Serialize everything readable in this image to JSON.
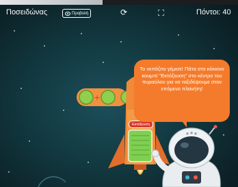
{
  "header": {
    "title": "Ποσειδώνας",
    "preview_label": "Προβολή",
    "points_label": "Πόντοι: 40"
  },
  "icons": {
    "preview": "eye-icon",
    "sync": "sync-icon",
    "fullscreen": "fullscreen-icon"
  },
  "dialog": {
    "text": "Το νεπόζιτο γέμισε! Πάτα στο κόκκινο κουμπί \"Εκτόξευση\" στο κέντρο του πυραύλου για να ταξιδέψουμε στον επόμενο πλανήτη!"
  },
  "rocket": {
    "launch_label": "Εκτόξευση",
    "fuel_level": 1.0
  },
  "colors": {
    "accent_orange": "#f47b2b",
    "launch_red": "#d63a2b",
    "fuel_green": "#8fd14f",
    "background": "#12383f"
  }
}
